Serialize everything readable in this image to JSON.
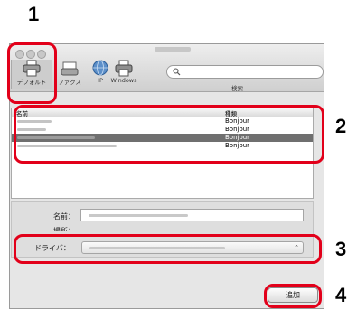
{
  "steps": [
    "1",
    "2",
    "3",
    "4"
  ],
  "toolbar": {
    "default_label": "デフォルト",
    "fax_label": "ファクス",
    "ip_label": "IP",
    "windows_label": "Windows",
    "search_placeholder": "検索",
    "search_icon": "search-icon"
  },
  "printer_list": {
    "columns": {
      "name": "名前",
      "kind": "種類"
    },
    "rows": [
      {
        "kind": "Bonjour",
        "selected": false
      },
      {
        "kind": "Bonjour",
        "selected": false
      },
      {
        "kind": "Bonjour",
        "selected": true
      },
      {
        "kind": "Bonjour",
        "selected": false
      }
    ]
  },
  "form": {
    "name_label": "名前：",
    "location_label": "場所：",
    "driver_label": "ドライバ："
  },
  "add_button": "追加",
  "colors": {
    "highlight": "#e2001a",
    "selected_row": "#6f6f6f"
  }
}
